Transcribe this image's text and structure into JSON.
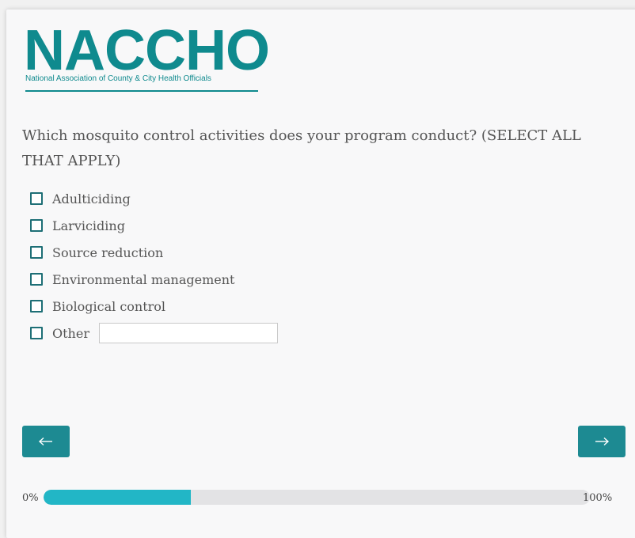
{
  "brand": {
    "logo_text": "NACCHO",
    "tagline": "National Association of County & City Health Officials",
    "color": "#0f8a8e"
  },
  "question": {
    "text": "Which mosquito control activities does your program conduct? (SELECT ALL THAT APPLY)"
  },
  "options": [
    {
      "label": "Adulticiding",
      "checked": false
    },
    {
      "label": "Larviciding",
      "checked": false
    },
    {
      "label": "Source reduction",
      "checked": false
    },
    {
      "label": "Environmental management",
      "checked": false
    },
    {
      "label": "Biological control",
      "checked": false
    },
    {
      "label": "Other",
      "checked": false,
      "text_value": ""
    }
  ],
  "navigation": {
    "back_icon": "arrow-left-icon",
    "next_icon": "arrow-right-icon",
    "button_color": "#1d8a92"
  },
  "progress": {
    "min_label": "0%",
    "max_label": "100%",
    "fraction": 0.27,
    "fill_color": "#22b6c6"
  }
}
